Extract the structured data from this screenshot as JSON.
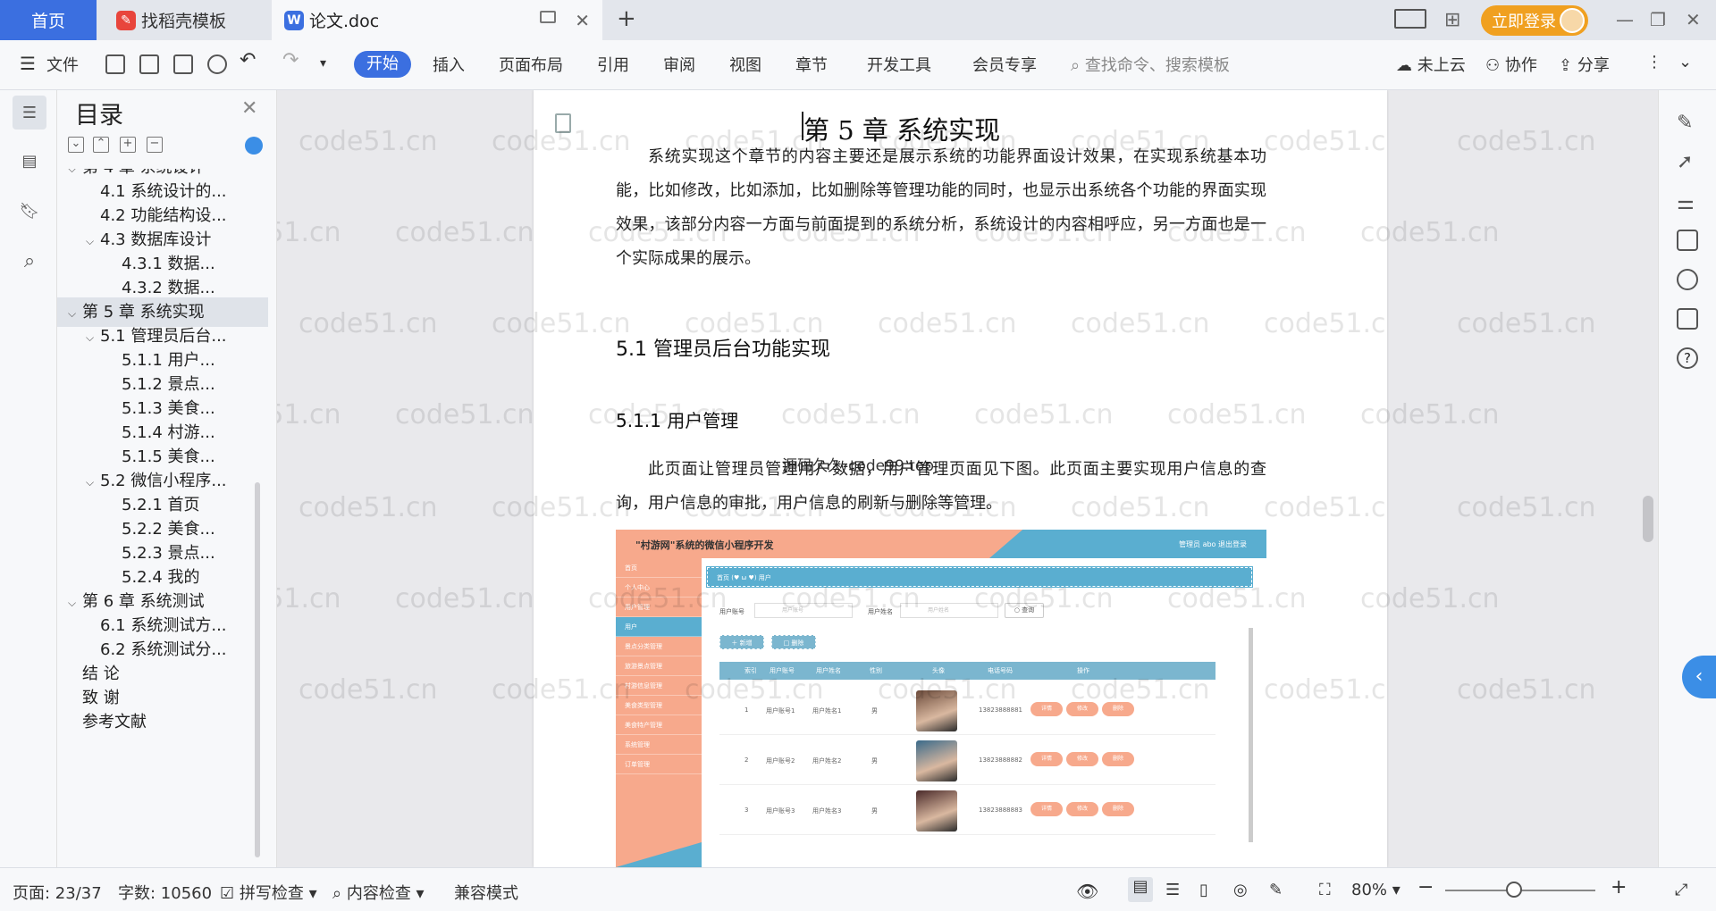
{
  "tabs": {
    "home": "首页",
    "daoke": "找稻壳模板",
    "doc": "论文.doc"
  },
  "login": {
    "label": "立即登录"
  },
  "ribbon": {
    "file": "文件",
    "menus": [
      "开始",
      "插入",
      "页面布局",
      "引用",
      "审阅",
      "视图",
      "章节",
      "开发工具",
      "会员专享"
    ],
    "search_placeholder": "查找命令、搜索模板",
    "cloud": "未上云",
    "collab": "协作",
    "share": "分享"
  },
  "toc": {
    "title": "目录",
    "items": [
      {
        "label": "第 4 章  系统设计",
        "level": 1,
        "expanded": true
      },
      {
        "label": "4.1 系统设计的...",
        "level": 2
      },
      {
        "label": "4.2 功能结构设...",
        "level": 2
      },
      {
        "label": "4.3 数据库设计",
        "level": 2,
        "expanded": true
      },
      {
        "label": "4.3.1 数据...",
        "level": 3
      },
      {
        "label": "4.3.2 数据...",
        "level": 3
      },
      {
        "label": "第 5 章  系统实现",
        "level": 1,
        "expanded": true,
        "selected": true
      },
      {
        "label": "5.1 管理员后台...",
        "level": 2,
        "expanded": true
      },
      {
        "label": "5.1.1 用户...",
        "level": 3
      },
      {
        "label": "5.1.2 景点...",
        "level": 3
      },
      {
        "label": "5.1.3 美食...",
        "level": 3
      },
      {
        "label": "5.1.4 村游...",
        "level": 3
      },
      {
        "label": "5.1.5 美食...",
        "level": 3
      },
      {
        "label": "5.2 微信小程序...",
        "level": 2,
        "expanded": true
      },
      {
        "label": "5.2.1 首页",
        "level": 3
      },
      {
        "label": "5.2.2 美食...",
        "level": 3
      },
      {
        "label": "5.2.3 景点...",
        "level": 3
      },
      {
        "label": "5.2.4 我的",
        "level": 3
      },
      {
        "label": "第 6 章  系统测试",
        "level": 1,
        "expanded": true
      },
      {
        "label": "6.1 系统测试方...",
        "level": 2
      },
      {
        "label": "6.2 系统测试分...",
        "level": 2
      },
      {
        "label": "结   论",
        "level": 1
      },
      {
        "label": "致   谢",
        "level": 1
      },
      {
        "label": "参考文献",
        "level": 1
      }
    ]
  },
  "document": {
    "chapter_title": "第 5 章  系统实现",
    "intro": "系统实现这个章节的内容主要还是展示系统的功能界面设计效果，在实现系统基本功能，比如修改，比如添加，比如删除等管理功能的同时，也显示出系统各个功能的界面实现效果，该部分内容一方面与前面提到的系统分析，系统设计的内容相呼应，另一方面也是一个实际成果的展示。",
    "h2": "5.1 管理员后台功能实现",
    "h3": "5.1.1  用户管理",
    "inline_watermark": "源码久久-code99.top",
    "para2": "此页面让管理员管理用户数据，用户管理页面见下图。此页面主要实现用户信息的查询，用户信息的审批，用户信息的刷新与删除等管理。",
    "watermark": "code51.cn"
  },
  "screenshot": {
    "title": "\"村游网\"系统的微信小程序开发",
    "user": "管理员 abo    退出登录",
    "breadcrumb": "首页 (♥ ω ♥) 用户",
    "menu": [
      "首页",
      "个人中心",
      "用户管理",
      "用户",
      "景点分类管理",
      "旅游景点管理",
      "村游信息管理",
      "美食类型管理",
      "美食特产管理",
      "系统管理",
      "订单管理"
    ],
    "search": {
      "l1": "用户账号",
      "p1": "用户账号",
      "l2": "用户姓名",
      "p2": "用户姓名",
      "btn": "○ 查询"
    },
    "add": "＋ 新增",
    "del": "□ 删除",
    "headers": [
      "",
      "索引",
      "用户账号",
      "用户姓名",
      "性别",
      "头像",
      "电话号码",
      "操作"
    ],
    "rows": [
      {
        "idx": "1",
        "acct": "用户账号1",
        "name": "用户姓名1",
        "sex": "男",
        "phone": "13823888881"
      },
      {
        "idx": "2",
        "acct": "用户账号2",
        "name": "用户姓名2",
        "sex": "男",
        "phone": "13823888882"
      },
      {
        "idx": "3",
        "acct": "用户账号3",
        "name": "用户姓名3",
        "sex": "男",
        "phone": "13823888883"
      }
    ],
    "actions": [
      "详情",
      "修改",
      "删除"
    ]
  },
  "status": {
    "page": "页面: 23/37",
    "words": "字数: 10560",
    "spell": "拼写检查",
    "content": "内容检查",
    "compat": "兼容模式",
    "zoom": "80%"
  },
  "colors": {
    "accent": "#3b6fe0",
    "salmon": "#f7a98c",
    "teal": "#5aaed0",
    "login": "#f0a020"
  }
}
